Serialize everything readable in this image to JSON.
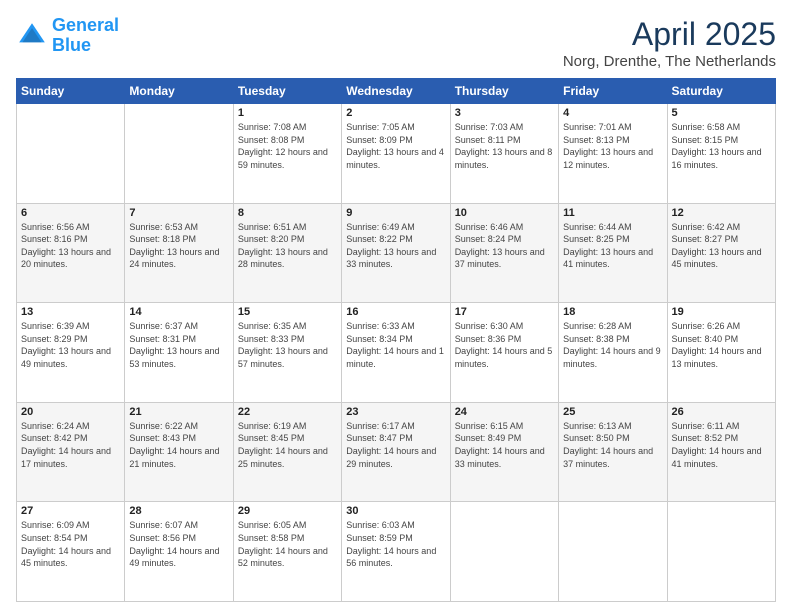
{
  "logo": {
    "line1": "General",
    "line2": "Blue"
  },
  "title": "April 2025",
  "subtitle": "Norg, Drenthe, The Netherlands",
  "days_of_week": [
    "Sunday",
    "Monday",
    "Tuesday",
    "Wednesday",
    "Thursday",
    "Friday",
    "Saturday"
  ],
  "weeks": [
    [
      {
        "day": "",
        "sunrise": "",
        "sunset": "",
        "daylight": ""
      },
      {
        "day": "",
        "sunrise": "",
        "sunset": "",
        "daylight": ""
      },
      {
        "day": "1",
        "sunrise": "Sunrise: 7:08 AM",
        "sunset": "Sunset: 8:08 PM",
        "daylight": "Daylight: 12 hours and 59 minutes."
      },
      {
        "day": "2",
        "sunrise": "Sunrise: 7:05 AM",
        "sunset": "Sunset: 8:09 PM",
        "daylight": "Daylight: 13 hours and 4 minutes."
      },
      {
        "day": "3",
        "sunrise": "Sunrise: 7:03 AM",
        "sunset": "Sunset: 8:11 PM",
        "daylight": "Daylight: 13 hours and 8 minutes."
      },
      {
        "day": "4",
        "sunrise": "Sunrise: 7:01 AM",
        "sunset": "Sunset: 8:13 PM",
        "daylight": "Daylight: 13 hours and 12 minutes."
      },
      {
        "day": "5",
        "sunrise": "Sunrise: 6:58 AM",
        "sunset": "Sunset: 8:15 PM",
        "daylight": "Daylight: 13 hours and 16 minutes."
      }
    ],
    [
      {
        "day": "6",
        "sunrise": "Sunrise: 6:56 AM",
        "sunset": "Sunset: 8:16 PM",
        "daylight": "Daylight: 13 hours and 20 minutes."
      },
      {
        "day": "7",
        "sunrise": "Sunrise: 6:53 AM",
        "sunset": "Sunset: 8:18 PM",
        "daylight": "Daylight: 13 hours and 24 minutes."
      },
      {
        "day": "8",
        "sunrise": "Sunrise: 6:51 AM",
        "sunset": "Sunset: 8:20 PM",
        "daylight": "Daylight: 13 hours and 28 minutes."
      },
      {
        "day": "9",
        "sunrise": "Sunrise: 6:49 AM",
        "sunset": "Sunset: 8:22 PM",
        "daylight": "Daylight: 13 hours and 33 minutes."
      },
      {
        "day": "10",
        "sunrise": "Sunrise: 6:46 AM",
        "sunset": "Sunset: 8:24 PM",
        "daylight": "Daylight: 13 hours and 37 minutes."
      },
      {
        "day": "11",
        "sunrise": "Sunrise: 6:44 AM",
        "sunset": "Sunset: 8:25 PM",
        "daylight": "Daylight: 13 hours and 41 minutes."
      },
      {
        "day": "12",
        "sunrise": "Sunrise: 6:42 AM",
        "sunset": "Sunset: 8:27 PM",
        "daylight": "Daylight: 13 hours and 45 minutes."
      }
    ],
    [
      {
        "day": "13",
        "sunrise": "Sunrise: 6:39 AM",
        "sunset": "Sunset: 8:29 PM",
        "daylight": "Daylight: 13 hours and 49 minutes."
      },
      {
        "day": "14",
        "sunrise": "Sunrise: 6:37 AM",
        "sunset": "Sunset: 8:31 PM",
        "daylight": "Daylight: 13 hours and 53 minutes."
      },
      {
        "day": "15",
        "sunrise": "Sunrise: 6:35 AM",
        "sunset": "Sunset: 8:33 PM",
        "daylight": "Daylight: 13 hours and 57 minutes."
      },
      {
        "day": "16",
        "sunrise": "Sunrise: 6:33 AM",
        "sunset": "Sunset: 8:34 PM",
        "daylight": "Daylight: 14 hours and 1 minute."
      },
      {
        "day": "17",
        "sunrise": "Sunrise: 6:30 AM",
        "sunset": "Sunset: 8:36 PM",
        "daylight": "Daylight: 14 hours and 5 minutes."
      },
      {
        "day": "18",
        "sunrise": "Sunrise: 6:28 AM",
        "sunset": "Sunset: 8:38 PM",
        "daylight": "Daylight: 14 hours and 9 minutes."
      },
      {
        "day": "19",
        "sunrise": "Sunrise: 6:26 AM",
        "sunset": "Sunset: 8:40 PM",
        "daylight": "Daylight: 14 hours and 13 minutes."
      }
    ],
    [
      {
        "day": "20",
        "sunrise": "Sunrise: 6:24 AM",
        "sunset": "Sunset: 8:42 PM",
        "daylight": "Daylight: 14 hours and 17 minutes."
      },
      {
        "day": "21",
        "sunrise": "Sunrise: 6:22 AM",
        "sunset": "Sunset: 8:43 PM",
        "daylight": "Daylight: 14 hours and 21 minutes."
      },
      {
        "day": "22",
        "sunrise": "Sunrise: 6:19 AM",
        "sunset": "Sunset: 8:45 PM",
        "daylight": "Daylight: 14 hours and 25 minutes."
      },
      {
        "day": "23",
        "sunrise": "Sunrise: 6:17 AM",
        "sunset": "Sunset: 8:47 PM",
        "daylight": "Daylight: 14 hours and 29 minutes."
      },
      {
        "day": "24",
        "sunrise": "Sunrise: 6:15 AM",
        "sunset": "Sunset: 8:49 PM",
        "daylight": "Daylight: 14 hours and 33 minutes."
      },
      {
        "day": "25",
        "sunrise": "Sunrise: 6:13 AM",
        "sunset": "Sunset: 8:50 PM",
        "daylight": "Daylight: 14 hours and 37 minutes."
      },
      {
        "day": "26",
        "sunrise": "Sunrise: 6:11 AM",
        "sunset": "Sunset: 8:52 PM",
        "daylight": "Daylight: 14 hours and 41 minutes."
      }
    ],
    [
      {
        "day": "27",
        "sunrise": "Sunrise: 6:09 AM",
        "sunset": "Sunset: 8:54 PM",
        "daylight": "Daylight: 14 hours and 45 minutes."
      },
      {
        "day": "28",
        "sunrise": "Sunrise: 6:07 AM",
        "sunset": "Sunset: 8:56 PM",
        "daylight": "Daylight: 14 hours and 49 minutes."
      },
      {
        "day": "29",
        "sunrise": "Sunrise: 6:05 AM",
        "sunset": "Sunset: 8:58 PM",
        "daylight": "Daylight: 14 hours and 52 minutes."
      },
      {
        "day": "30",
        "sunrise": "Sunrise: 6:03 AM",
        "sunset": "Sunset: 8:59 PM",
        "daylight": "Daylight: 14 hours and 56 minutes."
      },
      {
        "day": "",
        "sunrise": "",
        "sunset": "",
        "daylight": ""
      },
      {
        "day": "",
        "sunrise": "",
        "sunset": "",
        "daylight": ""
      },
      {
        "day": "",
        "sunrise": "",
        "sunset": "",
        "daylight": ""
      }
    ]
  ]
}
